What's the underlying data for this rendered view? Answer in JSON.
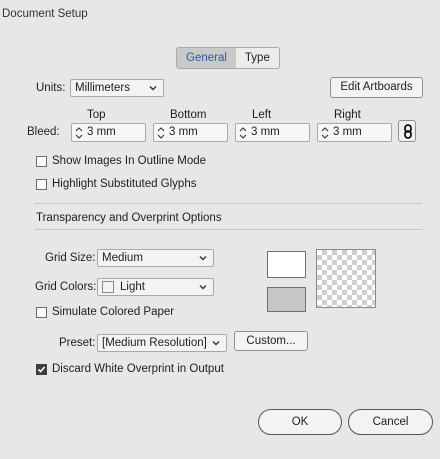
{
  "window": {
    "title": "Document Setup"
  },
  "tabs": [
    {
      "label": "General"
    },
    {
      "label": "Type"
    }
  ],
  "units": {
    "label": "Units:",
    "value": "Millimeters"
  },
  "edit_artboards_label": "Edit Artboards",
  "bleed": {
    "label": "Bleed:",
    "fields": [
      {
        "header": "Top",
        "value": "3 mm"
      },
      {
        "header": "Bottom",
        "value": "3 mm"
      },
      {
        "header": "Left",
        "value": "3 mm"
      },
      {
        "header": "Right",
        "value": "3 mm"
      }
    ]
  },
  "options": {
    "show_images_outline": {
      "label": "Show Images In Outline Mode",
      "checked": false
    },
    "highlight_glyphs": {
      "label": "Highlight Substituted Glyphs",
      "checked": false
    }
  },
  "transparency": {
    "section_title": "Transparency and Overprint Options",
    "grid_size": {
      "label": "Grid Size:",
      "value": "Medium"
    },
    "grid_colors": {
      "label": "Grid Colors:",
      "value": "Light"
    },
    "simulate_paper": {
      "label": "Simulate Colored Paper",
      "checked": false
    },
    "preset": {
      "label": "Preset:",
      "value": "[Medium Resolution]"
    },
    "custom_label": "Custom...",
    "discard_white": {
      "label": "Discard White Overprint in Output",
      "checked": true
    }
  },
  "buttons": {
    "ok": "OK",
    "cancel": "Cancel"
  }
}
